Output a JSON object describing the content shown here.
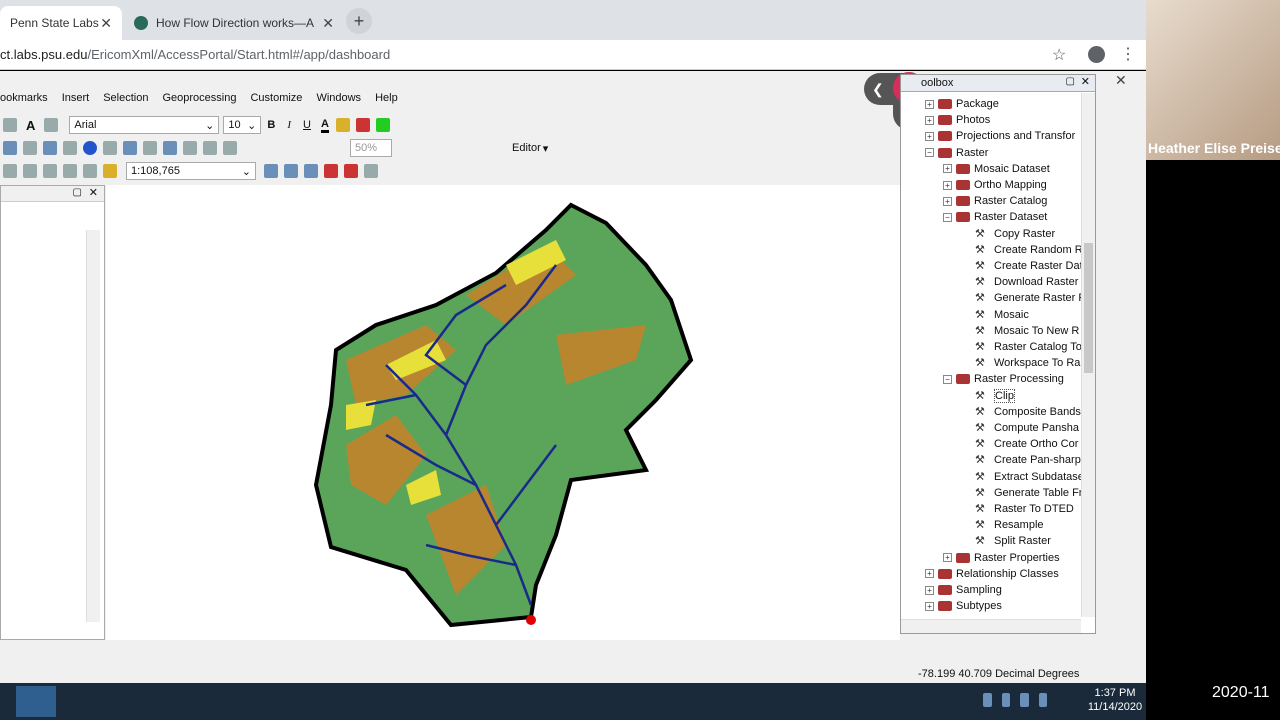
{
  "browser": {
    "tabs": [
      {
        "title": "Penn State Labs",
        "close": "✕"
      },
      {
        "title": "How Flow Direction works—A",
        "close": "✕"
      }
    ],
    "new_tab": "+",
    "url_prefix": "ct.labs.psu.edu",
    "url_path": "/EricomXml/AccessPortal/Start.html#/app/dashboard",
    "close_session": "✕"
  },
  "menu": [
    "ookmarks",
    "Insert",
    "Selection",
    "Geoprocessing",
    "Customize",
    "Windows",
    "Help"
  ],
  "toolbar": {
    "font_name": "Arial",
    "font_size": "10",
    "bold": "B",
    "italic": "I",
    "underline": "U",
    "zoom_pct": "50%",
    "editor": "Editor",
    "scale": "1:108,765"
  },
  "toolbox": {
    "title": "oolbox",
    "items": [
      {
        "label": "Package",
        "level": 1,
        "type": "toolset",
        "exp": "+"
      },
      {
        "label": "Photos",
        "level": 1,
        "type": "toolset",
        "exp": "+"
      },
      {
        "label": "Projections and Transfor",
        "level": 1,
        "type": "toolset",
        "exp": "+"
      },
      {
        "label": "Raster",
        "level": 1,
        "type": "toolset",
        "exp": "−"
      },
      {
        "label": "Mosaic Dataset",
        "level": 2,
        "type": "toolset",
        "exp": "+"
      },
      {
        "label": "Ortho Mapping",
        "level": 2,
        "type": "toolset",
        "exp": "+"
      },
      {
        "label": "Raster Catalog",
        "level": 2,
        "type": "toolset",
        "exp": "+"
      },
      {
        "label": "Raster Dataset",
        "level": 2,
        "type": "toolset",
        "exp": "−"
      },
      {
        "label": "Copy Raster",
        "level": 3,
        "type": "tool"
      },
      {
        "label": "Create Random R",
        "level": 3,
        "type": "tool"
      },
      {
        "label": "Create Raster Dat",
        "level": 3,
        "type": "tool"
      },
      {
        "label": "Download Raster",
        "level": 3,
        "type": "tool"
      },
      {
        "label": "Generate Raster F",
        "level": 3,
        "type": "tool"
      },
      {
        "label": "Mosaic",
        "level": 3,
        "type": "tool"
      },
      {
        "label": "Mosaic To New R",
        "level": 3,
        "type": "tool"
      },
      {
        "label": "Raster Catalog To",
        "level": 3,
        "type": "tool"
      },
      {
        "label": "Workspace To Ra",
        "level": 3,
        "type": "tool"
      },
      {
        "label": "Raster Processing",
        "level": 2,
        "type": "toolset",
        "exp": "−"
      },
      {
        "label": "Clip",
        "level": 3,
        "type": "tool"
      },
      {
        "label": "Composite Bands",
        "level": 3,
        "type": "tool"
      },
      {
        "label": "Compute Pansha",
        "level": 3,
        "type": "tool"
      },
      {
        "label": "Create Ortho Cor",
        "level": 3,
        "type": "tool"
      },
      {
        "label": "Create Pan-sharp",
        "level": 3,
        "type": "tool"
      },
      {
        "label": "Extract Subdatase",
        "level": 3,
        "type": "tool"
      },
      {
        "label": "Generate Table Fr",
        "level": 3,
        "type": "tool"
      },
      {
        "label": "Raster To DTED",
        "level": 3,
        "type": "tool"
      },
      {
        "label": "Resample",
        "level": 3,
        "type": "tool"
      },
      {
        "label": "Split Raster",
        "level": 3,
        "type": "tool"
      },
      {
        "label": "Raster Properties",
        "level": 2,
        "type": "toolset",
        "exp": "+"
      },
      {
        "label": "Relationship Classes",
        "level": 1,
        "type": "toolset",
        "exp": "+"
      },
      {
        "label": "Sampling",
        "level": 1,
        "type": "toolset",
        "exp": "+"
      },
      {
        "label": "Subtypes",
        "level": 1,
        "type": "toolset",
        "exp": "+"
      }
    ]
  },
  "status": {
    "coords": "-78.199  40.709 Decimal Degrees"
  },
  "taskbar": {
    "time": "1:37 PM",
    "date": "11/14/2020"
  },
  "video": {
    "name": "Heather Elise Preise",
    "timestamp": "2020-11"
  },
  "colors": {
    "land": "#5aa55a",
    "brown": "#b8862f",
    "yellow": "#e8e03a",
    "stream": "#1a2a8a",
    "accent": "#d62d5a"
  }
}
